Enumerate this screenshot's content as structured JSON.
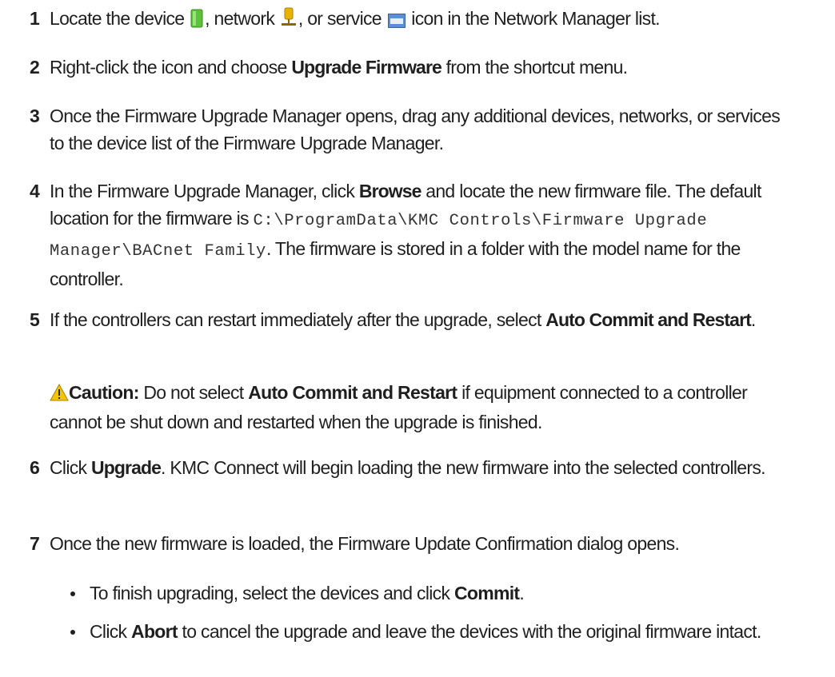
{
  "steps": [
    {
      "number": "1",
      "parts": [
        "Locate the device",
        ", network",
        ", or service",
        " icon in the Network Manager list."
      ],
      "icons": [
        "device-icon",
        "network-icon",
        "service-icon"
      ]
    },
    {
      "number": "2",
      "parts": [
        "Right-click the icon and choose ",
        "Upgrade Firmware",
        " from the shortcut menu."
      ]
    },
    {
      "number": "3",
      "text": "Once the Firmware Upgrade Manager opens, drag any additional devices, networks, or services to the device list of the Firmware Upgrade Manager."
    },
    {
      "number": "4",
      "parts": [
        "In the Firmware Upgrade Manager, click ",
        "Browse",
        " and locate the new firmware file. The default location for the firmware is ",
        "C:\\ProgramData\\KMC Controls\\Firmware Upgrade Manager\\BACnet Family",
        ". The firmware is stored in a folder with the model name for the controller."
      ]
    },
    {
      "number": "5",
      "parts": [
        "If the controllers can restart immediately after the upgrade, select ",
        "Auto Commit and Restart",
        "."
      ],
      "caution": {
        "icon": "warning-icon",
        "label": "Caution:",
        "parts": [
          " Do not select ",
          "Auto Commit and Restart",
          " if equipment connected to a controller cannot be shut down and restarted when the upgrade is finished."
        ]
      }
    },
    {
      "number": "6",
      "parts": [
        "Click ",
        "Upgrade",
        ". KMC Connect will begin loading the new firmware into the selected controllers."
      ]
    },
    {
      "number": "7",
      "text": "Once the new firmware is loaded, the Firmware Update Confirmation dialog opens.",
      "bullets": [
        {
          "parts": [
            "To finish upgrading, select the devices and click ",
            "Commit",
            "."
          ]
        },
        {
          "parts": [
            "Click ",
            "Abort",
            " to cancel the upgrade and leave the devices with the original firmware intact."
          ]
        }
      ]
    }
  ],
  "colors": {
    "text": "#1f1f1f",
    "device_icon_green": "#5cc23a",
    "network_icon_yellow": "#e8b400",
    "service_icon_blue": "#5b8fd6",
    "warning_yellow": "#f5c400"
  }
}
